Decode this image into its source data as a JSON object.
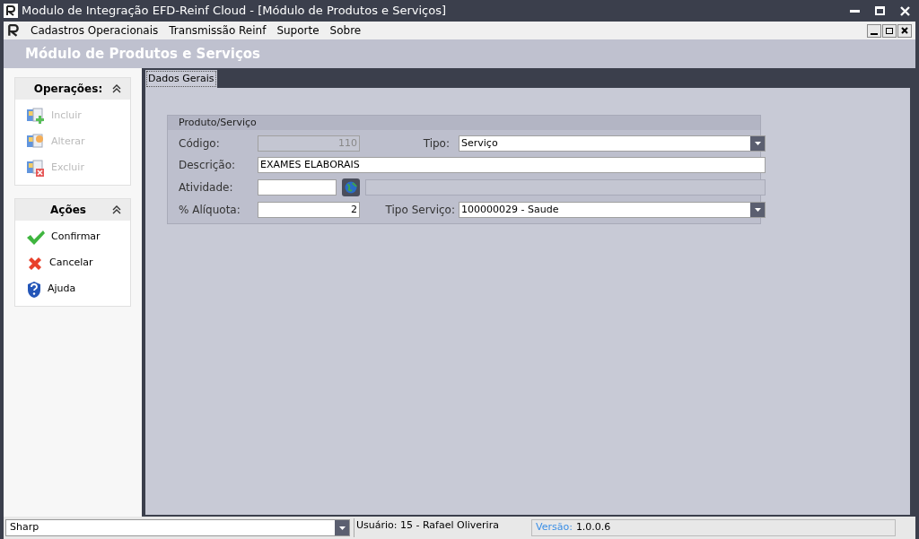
{
  "window": {
    "title": "Modulo de Integração EFD-Reinf Cloud - [Módulo de Produtos e Serviços]"
  },
  "menu": [
    "Cadastros Operacionais",
    "Transmissão Reinf",
    "Suporte",
    "Sobre"
  ],
  "header": {
    "title": "Módulo de Produtos e Serviços"
  },
  "sidebar": {
    "panels": [
      {
        "title": "Operações:",
        "expanded": true,
        "items": [
          {
            "label": "Incluir",
            "kind": "add",
            "disabled": true
          },
          {
            "label": "Alterar",
            "kind": "edit",
            "disabled": true
          },
          {
            "label": "Excluir",
            "kind": "delete",
            "disabled": true
          }
        ]
      },
      {
        "title": "Ações",
        "expanded": true,
        "items": [
          {
            "label": "Confirmar",
            "kind": "check",
            "disabled": false
          },
          {
            "label": "Cancelar",
            "kind": "cancel",
            "disabled": false
          },
          {
            "label": "Ajuda",
            "kind": "help",
            "disabled": false
          }
        ]
      }
    ]
  },
  "tabs": [
    {
      "label": "Dados Gerais",
      "selected": true
    }
  ],
  "group": {
    "title": "Produto/Serviço",
    "codigo": {
      "label": "Código:",
      "value": "110",
      "disabled": true
    },
    "tipo": {
      "label": "Tipo:",
      "value": "Serviço"
    },
    "descricao": {
      "label": "Descrição:",
      "value": "EXAMES ELABORAIS"
    },
    "atividade": {
      "label": "Atividade:"
    },
    "aliquota": {
      "label": "% Alíquota:",
      "value": "2"
    },
    "tipo_servico": {
      "label": "Tipo Serviço:",
      "value": "100000029 - Saude"
    }
  },
  "status_bar": {
    "theme": "Sharp",
    "user": "Usuário: 15 - Rafael Oliverira",
    "version_label": "Versão:",
    "version": "1.0.0.6"
  }
}
